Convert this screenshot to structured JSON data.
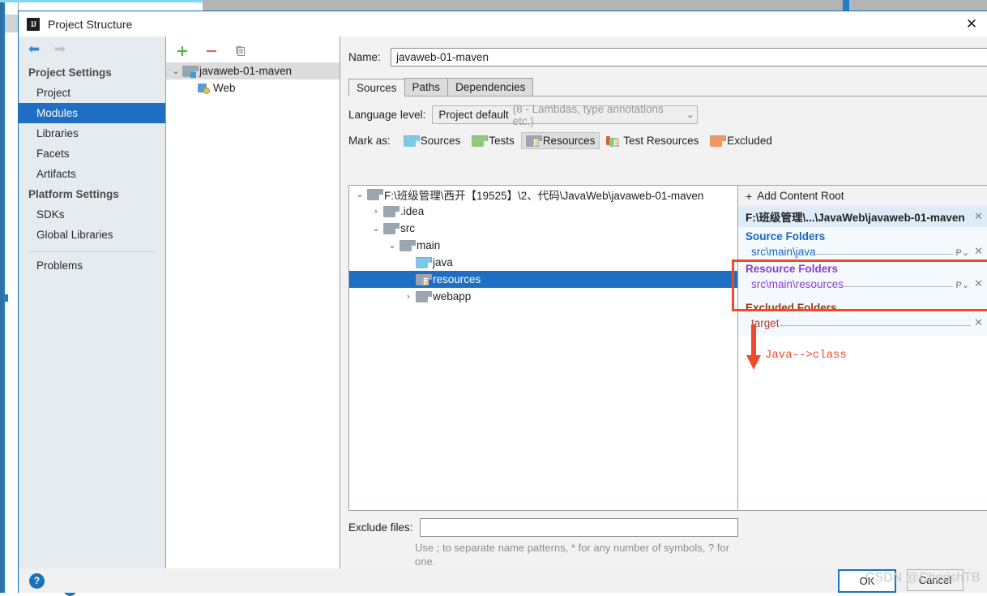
{
  "window": {
    "title": "Project Structure",
    "logo_text": "IJ",
    "close_icon": "✕"
  },
  "nav": {
    "back_icon": "⬅",
    "forward_icon": "➡",
    "groups": [
      {
        "label": "Project Settings",
        "items": [
          {
            "label": "Project",
            "selected": false
          },
          {
            "label": "Modules",
            "selected": true
          },
          {
            "label": "Libraries",
            "selected": false
          },
          {
            "label": "Facets",
            "selected": false
          },
          {
            "label": "Artifacts",
            "selected": false
          }
        ]
      },
      {
        "label": "Platform Settings",
        "items": [
          {
            "label": "SDKs",
            "selected": false
          },
          {
            "label": "Global Libraries",
            "selected": false
          }
        ]
      }
    ],
    "problems_label": "Problems"
  },
  "module_tree": {
    "toolbar": {
      "add_label": "+",
      "remove_label": "−",
      "copy_label": "copy-icon"
    },
    "rows": [
      {
        "label": "javaweb-01-maven",
        "twisty": "⌄",
        "icon": "module-folder-icon",
        "depth": 0,
        "selected": true
      },
      {
        "label": "Web",
        "twisty": "",
        "icon": "web-facet-icon",
        "depth": 1,
        "selected": false
      }
    ]
  },
  "main": {
    "name_label": "Name:",
    "name_value": "javaweb-01-maven",
    "tabs": [
      {
        "label": "Sources",
        "active": true
      },
      {
        "label": "Paths",
        "active": false
      },
      {
        "label": "Dependencies",
        "active": false
      }
    ],
    "language_level": {
      "label": "Language level:",
      "value": "Project default",
      "hint": "(8 - Lambdas, type annotations etc.)",
      "chevron": "⌄"
    },
    "mark_as": {
      "label": "Mark as:",
      "options": [
        {
          "label": "Sources",
          "icon": "folder-blue-icon",
          "active": false
        },
        {
          "label": "Tests",
          "icon": "folder-green-icon",
          "active": false
        },
        {
          "label": "Resources",
          "icon": "folder-resources-icon",
          "active": true
        },
        {
          "label": "Test Resources",
          "icon": "folder-test-resources-icon",
          "active": false
        },
        {
          "label": "Excluded",
          "icon": "folder-orange-icon",
          "active": false
        }
      ]
    },
    "source_tree": [
      {
        "label": "F:\\班级管理\\西开【19525】\\2、代码\\JavaWeb\\javaweb-01-maven",
        "twisty": "⌄",
        "icon": "folder-gray-icon",
        "depth": 0,
        "selected": false
      },
      {
        "label": ".idea",
        "twisty": "›",
        "icon": "folder-gray-icon",
        "depth": 1,
        "selected": false
      },
      {
        "label": "src",
        "twisty": "⌄",
        "icon": "folder-gray-icon",
        "depth": 1,
        "selected": false
      },
      {
        "label": "main",
        "twisty": "⌄",
        "icon": "folder-gray-icon",
        "depth": 2,
        "selected": false
      },
      {
        "label": "java",
        "twisty": "",
        "icon": "folder-blue-icon",
        "depth": 3,
        "selected": false
      },
      {
        "label": "resources",
        "twisty": "",
        "icon": "folder-resources-icon",
        "depth": 3,
        "selected": true
      },
      {
        "label": "webapp",
        "twisty": "›",
        "icon": "folder-gray-icon",
        "depth": 3,
        "selected": false
      }
    ],
    "exclude_files": {
      "label": "Exclude files:",
      "value": "",
      "hint": "Use ; to separate name patterns, * for any number of symbols, ? for one."
    }
  },
  "content_roots": {
    "add_label": "Add Content Root",
    "add_icon": "+",
    "root_path": "F:\\班级管理\\...\\JavaWeb\\javaweb-01-maven",
    "remove_icon": "✕",
    "sections": [
      {
        "title": "Source Folders",
        "kind": "src",
        "folders": [
          {
            "path": "src\\main\\java",
            "properties_icon": "P⌄",
            "remove_icon": "✕"
          }
        ]
      },
      {
        "title": "Resource Folders",
        "kind": "res",
        "folders": [
          {
            "path": "src\\main\\resources",
            "properties_icon": "P⌄",
            "remove_icon": "✕"
          }
        ]
      },
      {
        "title": "Excluded Folders",
        "kind": "exc",
        "folders": [
          {
            "path": "target",
            "properties_icon": "",
            "remove_icon": "✕"
          }
        ]
      }
    ]
  },
  "annotation": {
    "text": "Java-->class",
    "color": "#f04a2a",
    "highlight_color": "#f04a2a"
  },
  "bottom": {
    "help_label": "?",
    "buttons": [
      {
        "label": "OK",
        "default": true
      },
      {
        "label": "Cancel",
        "default": false
      }
    ]
  },
  "watermark": {
    "text": "CSDN @CherishTB"
  }
}
